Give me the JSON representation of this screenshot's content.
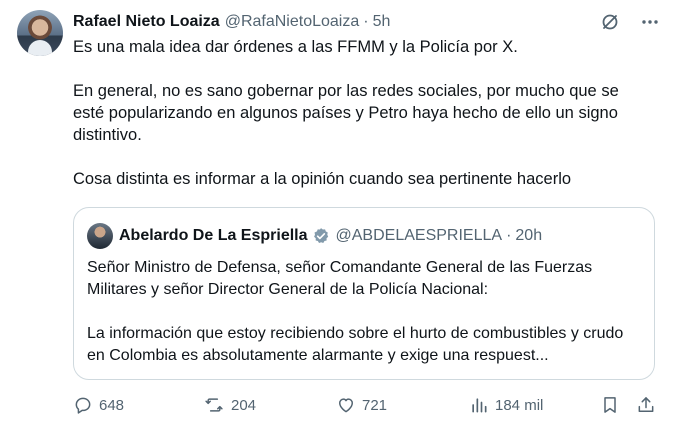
{
  "tweet": {
    "author_name": "Rafael Nieto Loaiza",
    "author_handle": "@RafaNietoLoaiza",
    "separator": "·",
    "time": "5h",
    "paragraphs": [
      "Es una mala idea dar órdenes a las FFMM y la Policía por X.",
      "En general, no es sano gobernar por las redes sociales, por mucho que se esté popularizando en algunos países y Petro haya hecho de ello un signo distintivo.",
      "Cosa distinta es informar a la opinión cuando sea pertinente hacerlo"
    ]
  },
  "quoted": {
    "author_name": "Abelardo De La Espriella",
    "author_handle": "@ABDELAESPRIELLA",
    "separator": "·",
    "time": "20h",
    "paragraphs": [
      "Señor Ministro de Defensa, señor Comandante General de las Fuerzas Militares y señor Director General de la Policía Nacional:",
      "La información que estoy recibiendo sobre el hurto de combustibles y crudo en Colombia es absolutamente alarmante y exige una respuest..."
    ]
  },
  "actions": {
    "replies": "648",
    "reposts": "204",
    "likes": "721",
    "views": "184 mil"
  },
  "colors": {
    "text": "#0f1419",
    "muted": "#536471",
    "border": "#cfd9de",
    "verified": "#829aab"
  },
  "icons": [
    "grok-icon",
    "more-icon",
    "verified-badge-icon",
    "reply-icon",
    "repost-icon",
    "like-icon",
    "views-icon",
    "bookmark-icon",
    "share-icon"
  ]
}
